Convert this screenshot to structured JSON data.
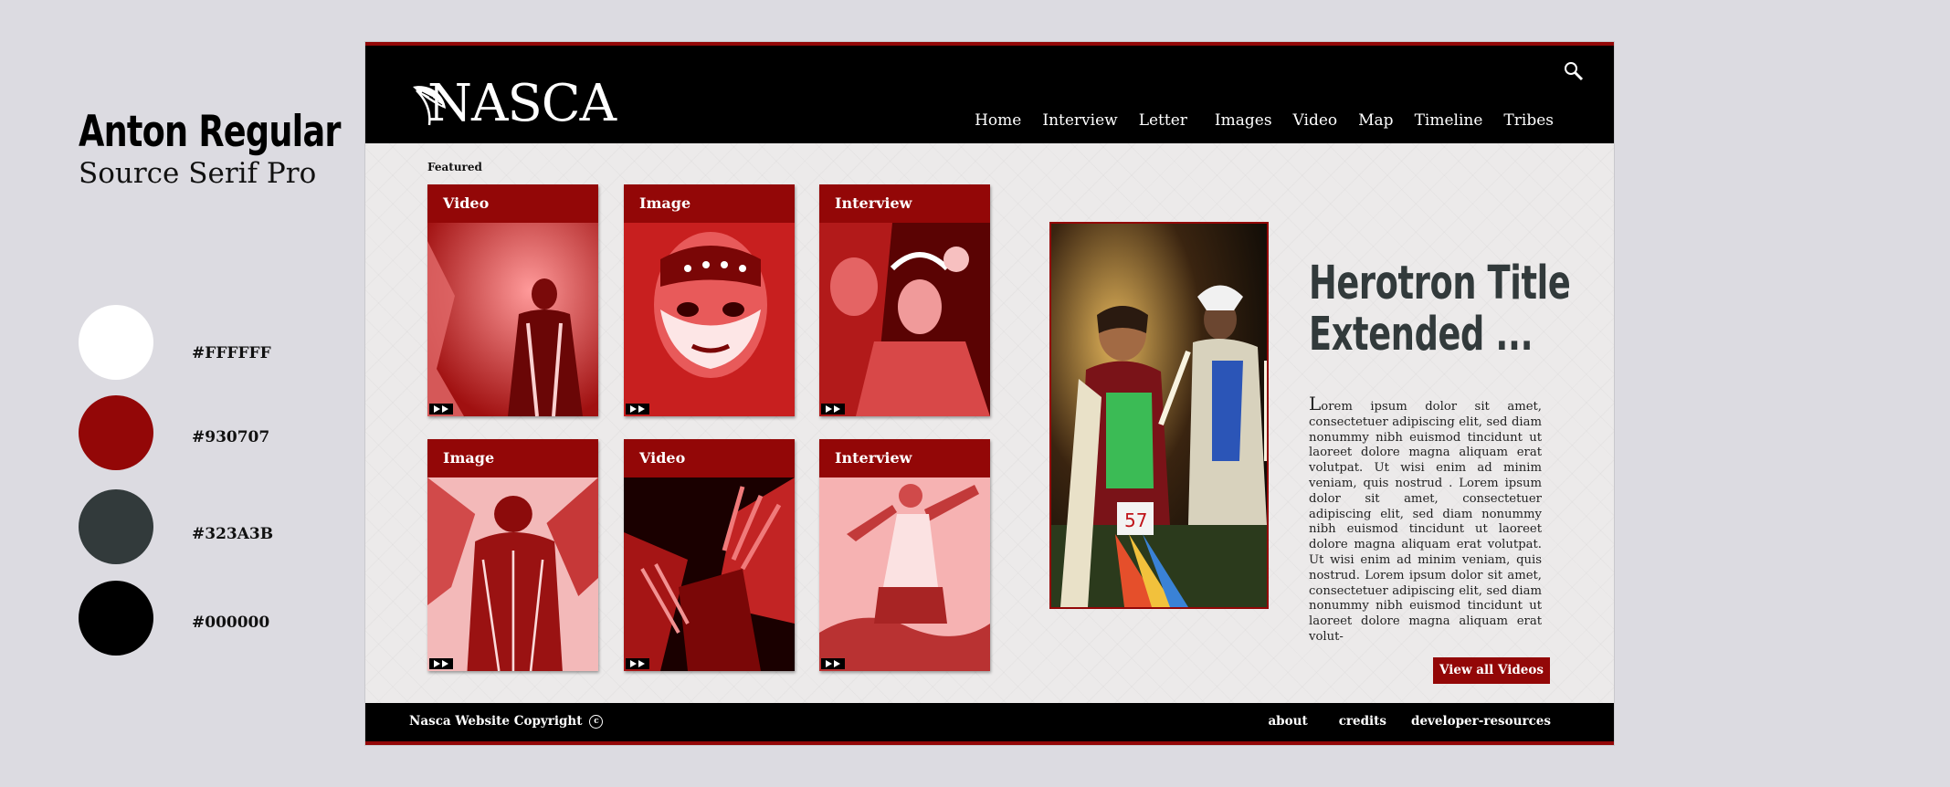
{
  "guide": {
    "fonts": [
      "Anton Regular",
      "Source Serif Pro"
    ],
    "colors": [
      {
        "hex": "#FFFFFF",
        "label": "#FFFFFF"
      },
      {
        "hex": "#930707",
        "label": "#930707"
      },
      {
        "hex": "#323A3B",
        "label": "#323A3B"
      },
      {
        "hex": "#000000",
        "label": "#000000"
      }
    ]
  },
  "site": {
    "logo": "NASCA",
    "nav": [
      "Home",
      "Interview",
      "Letter",
      "Images",
      "Video",
      "Map",
      "Timeline",
      "Tribes"
    ],
    "featured_label": "Featured",
    "cards": [
      {
        "label": "Video"
      },
      {
        "label": "Image"
      },
      {
        "label": "Interview"
      },
      {
        "label": "Image"
      },
      {
        "label": "Video"
      },
      {
        "label": "Interview"
      }
    ],
    "hero": {
      "title_line1": "Herotron Title",
      "title_line2": "Extended ...",
      "body": "Lorem ipsum dolor sit amet, consectetuer adipiscing elit, sed diam nonummy nibh euismod tincidunt ut laoreet dolore magna aliquam erat volutpat. Ut wisi enim ad minim veniam, quis nostrud . Lorem ipsum dolor sit amet, consectetuer adipiscing elit, sed diam nonummy nibh euismod tincidunt ut laoreet dolore magna aliquam erat volutpat. Ut wisi enim ad minim veniam, quis nostrud. Lorem ipsum dolor sit amet, consectetuer adipiscing elit, sed diam nonummy nibh euismod tincidunt ut laoreet dolore magna aliquam erat volut-",
      "button": "View all Videos"
    },
    "footer": {
      "copyright": "Nasca Website Copyright",
      "copy_symbol": "c",
      "links": [
        "about",
        "credits",
        "developer-resources"
      ]
    },
    "accent": "#930707",
    "dark": "#323A3B"
  }
}
